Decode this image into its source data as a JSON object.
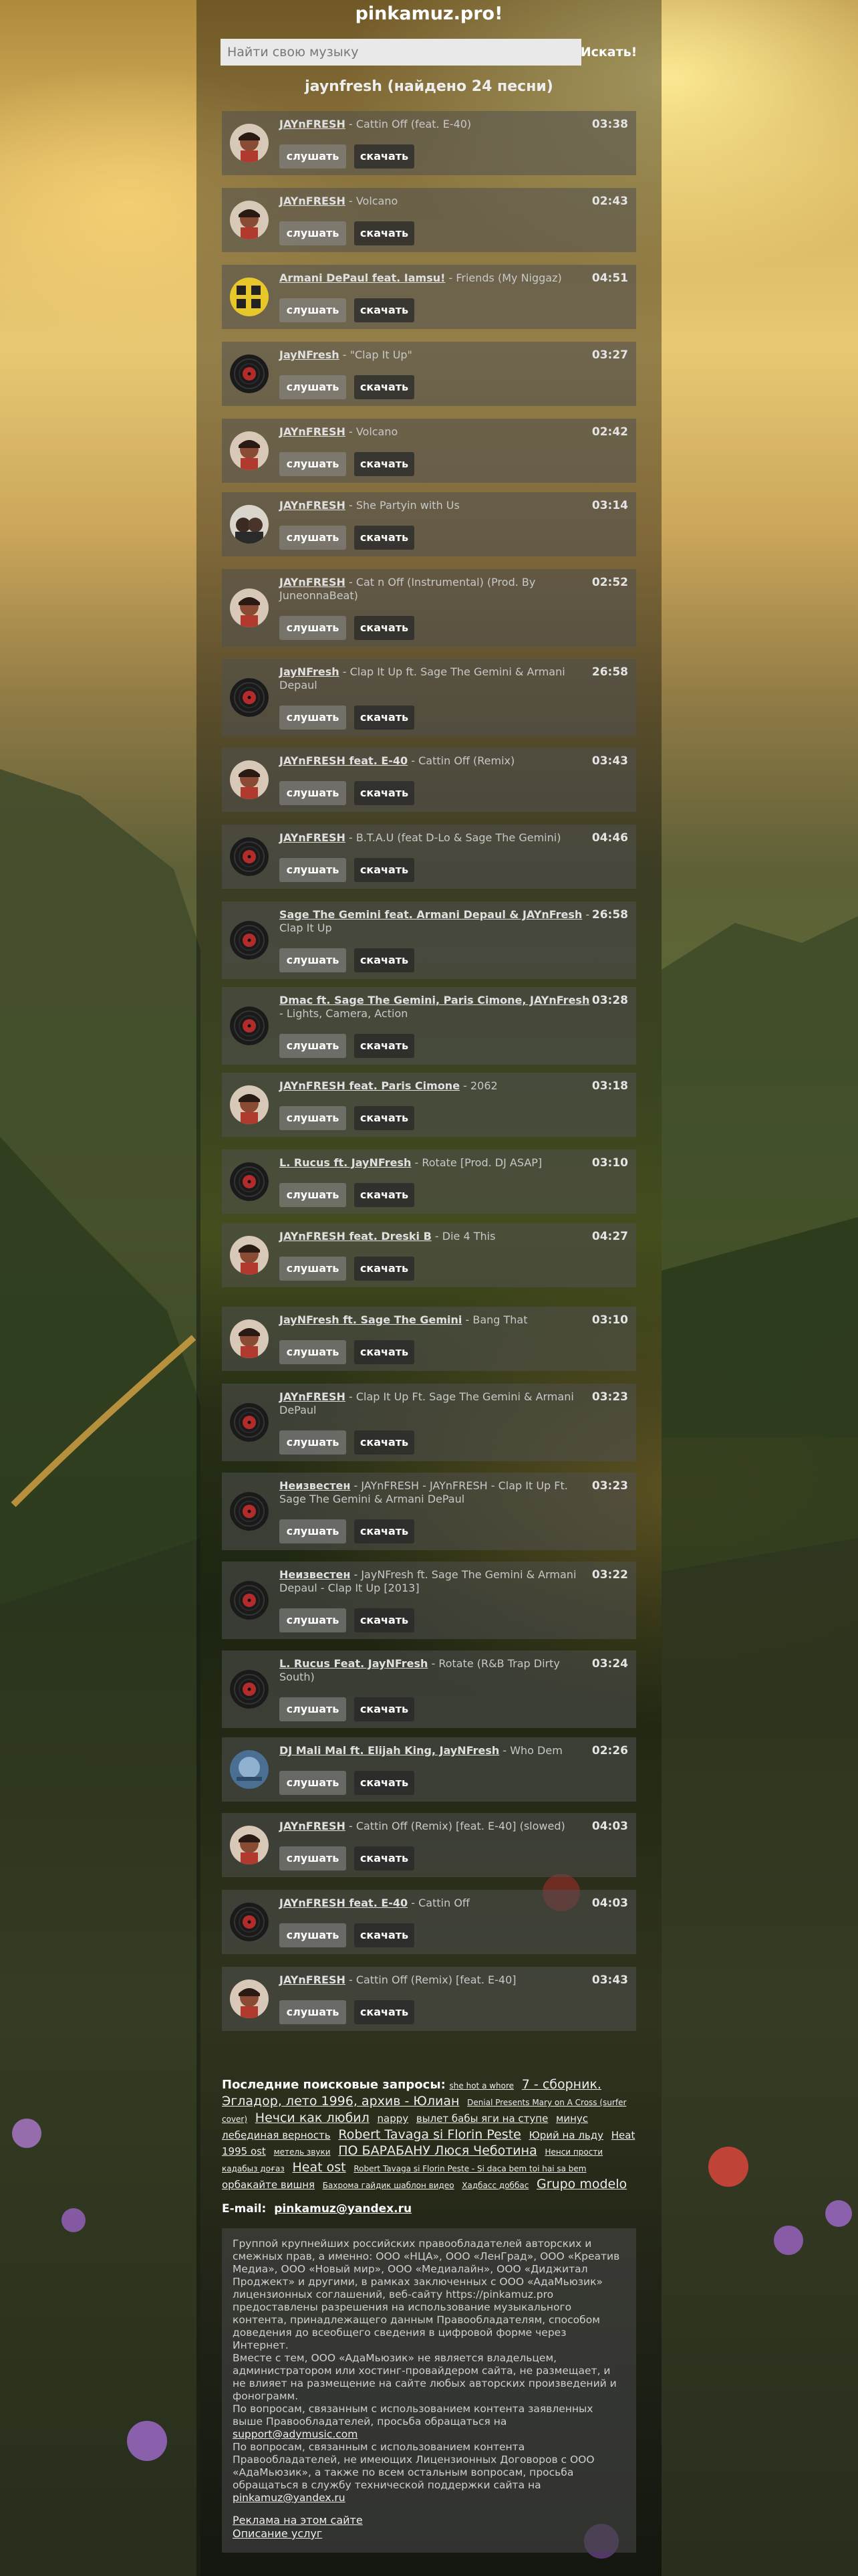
{
  "site": {
    "title": "pinkamuz.pro!"
  },
  "search": {
    "placeholder": "Найти свою музыку",
    "button_label": "Искать!"
  },
  "results": {
    "title": "jaynfresh (найдено 24 песни)"
  },
  "labels": {
    "listen": "слушать",
    "download": "скачать"
  },
  "tracks": [
    {
      "artist": "JAYnFRESH",
      "title": " - Cattin Off (feat. E-40)",
      "duration": "03:38",
      "thumb": "portrait"
    },
    {
      "artist": "JAYnFRESH",
      "title": " - Volcano",
      "duration": "02:43",
      "thumb": "portrait"
    },
    {
      "artist": "Armani DePaul feat. Iamsu!",
      "title": " - Friends (My Niggaz)",
      "duration": "04:51",
      "thumb": "yellow-art"
    },
    {
      "artist": "JayNFresh",
      "title": " - \"Clap It Up\"",
      "duration": "03:27",
      "thumb": "vinyl"
    },
    {
      "artist": "JAYnFRESH",
      "title": " - Volcano",
      "duration": "02:42",
      "thumb": "portrait"
    },
    {
      "artist": "JAYnFRESH",
      "title": " - She Partyin with Us",
      "duration": "03:14",
      "thumb": "group"
    },
    {
      "artist": "JAYnFRESH",
      "title": " - Cat n Off (Instrumental) (Prod. By JuneonnaBeat)",
      "duration": "02:52",
      "thumb": "portrait"
    },
    {
      "artist": "JayNFresh",
      "title": " - Clap It Up ft. Sage The Gemini & Armani Depaul",
      "duration": "26:58",
      "thumb": "vinyl"
    },
    {
      "artist": "JAYnFRESH feat. E-40",
      "title": " - Cattin Off (Remix)",
      "duration": "03:43",
      "thumb": "portrait"
    },
    {
      "artist": "JAYnFRESH",
      "title": " - B.T.A.U (feat D-Lo & Sage The Gemini)",
      "duration": "04:46",
      "thumb": "vinyl"
    },
    {
      "artist": "Sage The Gemini feat. Armani Depaul & JAYnFresh",
      "title": " - Clap It Up",
      "duration": "26:58",
      "thumb": "vinyl"
    },
    {
      "artist": "Dmac ft. Sage The Gemini, Paris Cimone, JAYnFresh",
      "title": " - Lights, Camera, Action",
      "duration": "03:28",
      "thumb": "vinyl"
    },
    {
      "artist": "JAYnFRESH feat. Paris Cimone",
      "title": " - 2062",
      "duration": "03:18",
      "thumb": "portrait"
    },
    {
      "artist": "L. Rucus ft. JayNFresh",
      "title": " - Rotate [Prod. DJ ASAP]",
      "duration": "03:10",
      "thumb": "vinyl"
    },
    {
      "artist": "JAYnFRESH feat. Dreski B",
      "title": " - Die 4 This",
      "duration": "04:27",
      "thumb": "portrait"
    },
    {
      "artist": "JayNFresh ft. Sage The Gemini",
      "title": " - Bang That",
      "duration": "03:10",
      "thumb": "portrait"
    },
    {
      "artist": "JAYnFRESH",
      "title": " - Clap It Up Ft. Sage The Gemini & Armani DePaul",
      "duration": "03:23",
      "thumb": "vinyl"
    },
    {
      "artist": "Неизвестен",
      "title": " - JAYnFRESH - JAYnFRESH - Clap It Up Ft. Sage The Gemini & Armani DePaul",
      "duration": "03:23",
      "thumb": "vinyl"
    },
    {
      "artist": "Неизвестен",
      "title": " - JayNFresh ft. Sage The Gemini & Armani Depaul - Clap It Up [2013]",
      "duration": "03:22",
      "thumb": "vinyl"
    },
    {
      "artist": "L. Rucus Feat. JayNFresh",
      "title": " - Rotate (R&B Trap Dirty South)",
      "duration": "03:24",
      "thumb": "vinyl"
    },
    {
      "artist": "DJ Mali Mal ft. Elijah King, JayNFresh",
      "title": " - Who Dem",
      "duration": "02:26",
      "thumb": "blue-art"
    },
    {
      "artist": "JAYnFRESH",
      "title": " - Cattin Off (Remix) [feat. E-40] (slowed)",
      "duration": "04:03",
      "thumb": "portrait"
    },
    {
      "artist": "JAYnFRESH feat. E-40",
      "title": " - Cattin Off",
      "duration": "04:03",
      "thumb": "vinyl"
    },
    {
      "artist": "JAYnFRESH",
      "title": " - Cattin Off (Remix) [feat. E-40]",
      "duration": "03:43",
      "thumb": "portrait"
    }
  ],
  "recent": {
    "label": "Последние поисковые запросы:",
    "queries": [
      {
        "text": "she hot a whore",
        "size": 1
      },
      {
        "text": "7 - сборник. Эгладор, лето 1996, архив - Юлиан",
        "size": 3
      },
      {
        "text": "Denial Presents Mary on A Cross (surfer cover)",
        "size": 1
      },
      {
        "text": "Нечси как любил",
        "size": 3
      },
      {
        "text": "nappy",
        "size": 2
      },
      {
        "text": "вылет бабы яги на ступе",
        "size": 2
      },
      {
        "text": "минус лебединая верность",
        "size": 2
      },
      {
        "text": "Robert Tavaga si Florin Peste",
        "size": 3
      },
      {
        "text": "Юрий на льду",
        "size": 2
      },
      {
        "text": "Heat 1995 ost",
        "size": 2
      },
      {
        "text": "метель звуки",
        "size": 1
      },
      {
        "text": "ПО БАРАБАНУ Люся Чеботина",
        "size": 3
      },
      {
        "text": "Ненси прости",
        "size": 1
      },
      {
        "text": "кадабыз доғаз",
        "size": 1
      },
      {
        "text": "Heat ost",
        "size": 3
      },
      {
        "text": "Robert Tavaga si Florin Peste - Si daca bem toi hai sa bem",
        "size": 1
      },
      {
        "text": "орбакайте вишня",
        "size": 2
      },
      {
        "text": "Бахрома гайдик шаблон видео",
        "size": 1
      },
      {
        "text": "Хадбасс доббас",
        "size": 1
      },
      {
        "text": "Grupo modelo",
        "size": 3
      }
    ]
  },
  "contact": {
    "label": "E-mail:",
    "email": "pinkamuz@yandex.ru"
  },
  "copyright": {
    "p1": "Группой крупнейших российских правообладателей авторских и смежных прав, а именно: ООО «НЦА», ООО «ЛенГрад», ООО «Креатив Медиа», ООО «Новый мир», ООО «Медиалайн», ООО «Диджитал Проджект» и другими, в рамках заключенных с ООО «АдаМьюзик» лицензионных соглашений, веб-сайту https://pinkamuz.pro предоставлены разрешения на использование музыкального контента, принадлежащего данным Правообладателям, способом доведения до всеобщего сведения в цифровой форме через Интернет.",
    "p2": "Вместе с тем, ООО «АдаМьюзик» не является владельцем, администратором или хостинг-провайдером сайта, не размещает, и не влияет на размещение на сайте любых авторских произведений и фонограмм.",
    "p3_text": "По вопросам, связанным с использованием контента заявленных выше Правообладателей, просьба обращаться на ",
    "p3_email": "support@adymusic.com",
    "p4_text": "По вопросам, связанным с использованием контента Правообладателей, не имеющих Лицензионных Договоров с ООО «АдаМьюзик», а также по всем остальным вопросам, просьба обращаться в службу технической поддержки сайта на ",
    "p4_email": "pinkamuz@yandex.ru",
    "link_ads": "Реклама на этом сайте",
    "link_services": "Описание услуг"
  }
}
